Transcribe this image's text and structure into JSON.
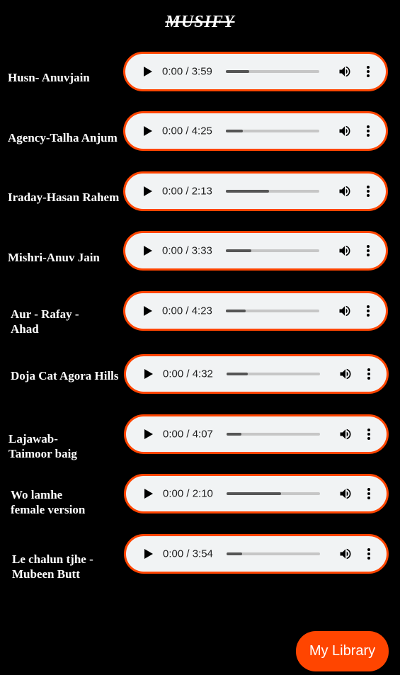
{
  "app": {
    "title": "MUSIFY"
  },
  "songs": [
    {
      "title": "Husn- Anuvjain",
      "time": "0:00 / 3:59",
      "progress": 0.25
    },
    {
      "title": "Agency-Talha Anjum",
      "time": "0:00 / 4:25",
      "progress": 0.18
    },
    {
      "title": "Iraday-Hasan Rahem",
      "time": "0:00 / 2:13",
      "progress": 0.46
    },
    {
      "title": "Mishri-Anuv Jain",
      "time": "0:00 / 3:33",
      "progress": 0.27
    },
    {
      "title": "Aur - Rafay - Ahad",
      "time": "0:00 / 4:23",
      "progress": 0.21
    },
    {
      "title": "Doja Cat Agora Hills",
      "time": "0:00 / 4:32",
      "progress": 0.23
    },
    {
      "title": "Lajawab-Taimoor baig",
      "time": "0:00 / 4:07",
      "progress": 0.16
    },
    {
      "title": "Wo lamhe female version",
      "time": "0:00 / 2:10",
      "progress": 0.58
    },
    {
      "title": "Le chalun tjhe - Mubeen Butt",
      "time": "0:00 / 3:54",
      "progress": 0.17
    }
  ],
  "library_button": {
    "label": "My Library"
  },
  "colors": {
    "accent": "#ff4500",
    "background": "#000000",
    "player_bg": "#f1f3f4"
  }
}
